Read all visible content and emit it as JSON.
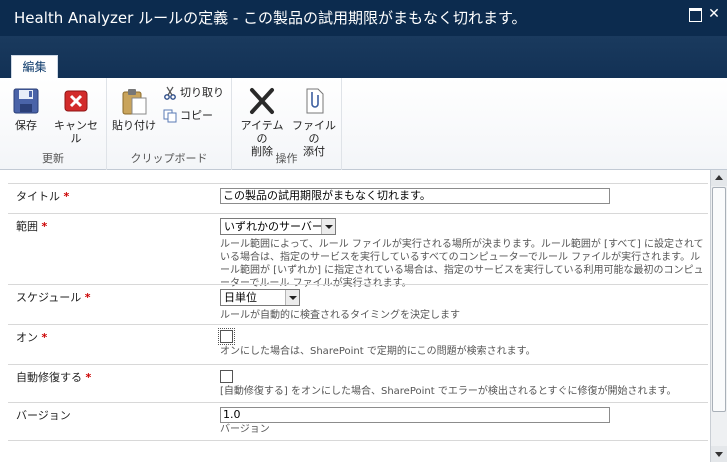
{
  "window": {
    "title": "Health Analyzer ルールの定義 - この製品の試用期限がまもなく切れます。",
    "maximize_icon": "maximize-icon",
    "close_icon": "close-icon"
  },
  "ribbon": {
    "tab_label": "編集",
    "groups": [
      {
        "label": "更新",
        "buttons": [
          "保存",
          "キャンセル"
        ]
      },
      {
        "label": "クリップボード",
        "buttons": [
          "貼り付け",
          "切り取り",
          "コピー"
        ]
      },
      {
        "label": "操作",
        "buttons": [
          "アイテムの\n削除",
          "ファイルの\n添付"
        ]
      }
    ],
    "save": "保存",
    "cancel": "キャンセル",
    "paste": "貼り付け",
    "cut": "切り取り",
    "copy": "コピー",
    "delete_line1": "アイテムの",
    "delete_line2": "削除",
    "attach_line1": "ファイルの",
    "attach_line2": "添付",
    "group_update": "更新",
    "group_clipboard": "クリップボード",
    "group_actions": "操作"
  },
  "form": {
    "title": {
      "label": "タイトル",
      "required": "*",
      "value": "この製品の試用期限がまもなく切れます。"
    },
    "scope": {
      "label": "範囲",
      "required": "*",
      "selected": "いずれかのサーバー",
      "desc": "ルール範囲によって、ルール ファイルが実行される場所が決まります。ルール範囲が [すべて] に設定されている場合は、指定のサービスを実行しているすべてのコンピューターでルール ファイルが実行されます。ルール範囲が [いずれか] に指定されている場合は、指定のサービスを実行している利用可能な最初のコンピューターでルール ファイルが実行されます。"
    },
    "schedule": {
      "label": "スケジュール",
      "required": "*",
      "selected": "日単位",
      "desc": "ルールが自動的に検査されるタイミングを決定します"
    },
    "enabled": {
      "label": "オン",
      "required": "*",
      "checked": false,
      "desc": "オンにした場合は、SharePoint で定期的にこの問題が検索されます。"
    },
    "auto_repair": {
      "label": "自動修復する",
      "required": "*",
      "checked": false,
      "desc": "[自動修復する] をオンにした場合、SharePoint でエラーが検出されるとすぐに修復が開始されます。"
    },
    "version": {
      "label": "バージョン",
      "value": "1.0",
      "desc": "バージョン"
    }
  },
  "colors": {
    "titlebar": "#0c2b4e",
    "required_marker": "#cc0000",
    "tab_text": "#0d3a6b"
  }
}
